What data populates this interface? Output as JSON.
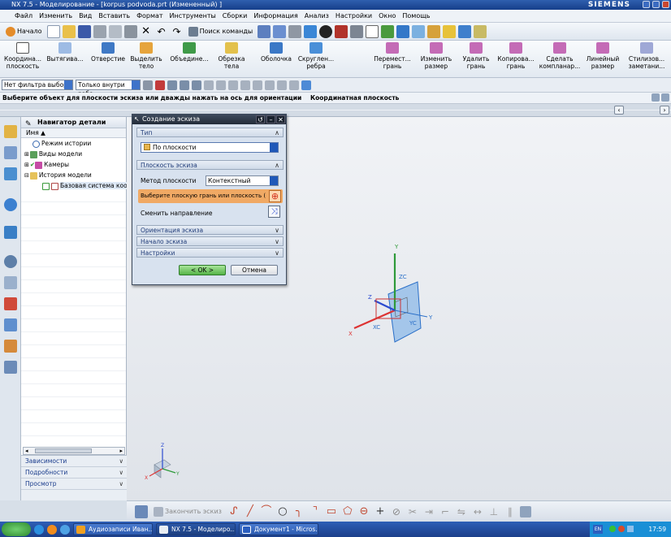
{
  "window": {
    "title": "NX 7.5 - Моделирование - [korpus podvoda.prt (Измененный) ]",
    "brand": "SIEMENS"
  },
  "menu": [
    "Файл",
    "Изменить",
    "Вид",
    "Вставить",
    "Формат",
    "Инструменты",
    "Сборки",
    "Информация",
    "Анализ",
    "Настройки",
    "Окно",
    "Помощь"
  ],
  "quick_toolbar": {
    "start_label": "Начало",
    "search_label": "Поиск команды"
  },
  "ribbon": [
    "Координа... плоскость",
    "Вытягива...",
    "Отверстие",
    "Выделить тело",
    "Объедине...",
    "Обрезка тела",
    "Оболочка",
    "Скруглен... ребра",
    "Перемест... грань",
    "Изменить размер",
    "Удалить грань",
    "Копирова... грань",
    "Сделать компланар...",
    "Линейный размер",
    "Стилизов... заметани..."
  ],
  "filter": {
    "type_filter": "Нет фильтра выбор",
    "scope_filter": "Только внутри рабо"
  },
  "cue": {
    "prompt": "Выберите объект для плоскости эскиза или дважды нажать на ось для ориентации",
    "status": "Координатная плоскость"
  },
  "navigator": {
    "title": "Навигатор детали",
    "column": "Имя",
    "items": [
      {
        "label": "Режим истории",
        "indent": 1
      },
      {
        "label": "Виды модели",
        "indent": 0
      },
      {
        "label": "Камеры",
        "indent": 0
      },
      {
        "label": "История модели",
        "indent": 0
      },
      {
        "label": "Базовая система коо...",
        "indent": 2
      }
    ],
    "footer": [
      "Зависимости",
      "Подробности",
      "Просмотр"
    ]
  },
  "dialog": {
    "title": "Создание эскиза",
    "sections": {
      "type": "Тип",
      "plane": "Плоскость эскиза",
      "orientation": "Ориентация эскиза",
      "origin": "Начало эскиза",
      "settings": "Настройки"
    },
    "type_value": "По плоскости",
    "plane_method_label": "Метод плоскости",
    "plane_method_value": "Контекстный",
    "select_prompt": "Выберите плоскую грань или плоскость (",
    "flip_label": "Сменить направление",
    "ok": "< OK >",
    "cancel": "Отмена"
  },
  "viewport": {
    "axis_labels": [
      "Y",
      "ZC",
      "Z",
      "X",
      "XC",
      "YC"
    ],
    "mini_axes": [
      "Z",
      "X",
      "Y"
    ]
  },
  "bottom_toolbar": {
    "finish_sketch": "Закончить эскиз"
  },
  "taskbar": {
    "tasks": [
      "Аудиозаписи Иван...",
      "NX 7.5 - Моделиро...",
      "Документ1 - Micros..."
    ],
    "lang": "EN",
    "time": "17:59"
  },
  "colors": {
    "accent": "#f0a964",
    "dialog_title": "#2b3443",
    "viewport_bg": "#e8ebef"
  }
}
